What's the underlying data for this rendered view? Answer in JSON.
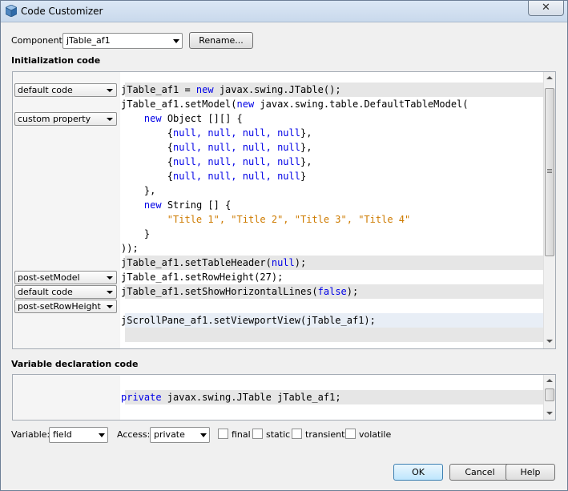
{
  "window": {
    "title": "Code Customizer",
    "close_glyph": "✕"
  },
  "component": {
    "label": "Component:",
    "value": "jTable_af1",
    "rename_label": "Rename..."
  },
  "init": {
    "heading": "Initialization code",
    "combos": [
      "default code",
      "custom property",
      "post-setModel",
      "default code",
      "post-setRowHeight"
    ],
    "lines": [
      [
        "",
        "jTable_af1 = ",
        "new",
        " javax.swing.JTable();"
      ],
      [
        "",
        "jTable_af1.setModel(",
        "new",
        " javax.swing.table.DefaultTableModel("
      ],
      [
        "    ",
        "",
        "new",
        " Object [][] {"
      ],
      [
        "        ",
        "{",
        "null, null, null, null",
        "},"
      ],
      [
        "        ",
        "{",
        "null, null, null, null",
        "},"
      ],
      [
        "        ",
        "{",
        "null, null, null, null",
        "},"
      ],
      [
        "        ",
        "{",
        "null, null, null, null",
        "}"
      ],
      [
        "    ",
        "},",
        "",
        ""
      ],
      [
        "    ",
        "",
        "new",
        " String [] {"
      ],
      [
        "        ",
        "",
        "\"Title 1\", \"Title 2\", \"Title 3\", \"Title 4\"",
        ""
      ],
      [
        "    ",
        "}",
        "",
        ""
      ],
      [
        "",
        "));",
        "",
        ""
      ],
      [
        "",
        "jTable_af1.setTableHeader(",
        "null",
        ");"
      ],
      [
        "",
        "jTable_af1.setRowHeight(27);",
        "",
        ""
      ],
      [
        "",
        "jTable_af1.setShowHorizontalLines(",
        "false",
        ");"
      ],
      [
        "",
        "",
        "",
        ""
      ],
      [
        "",
        "jScrollPane_af1.setViewportView(jTable_af1);",
        "",
        ""
      ]
    ]
  },
  "vardecl": {
    "heading": "Variable declaration code",
    "keyword": "private",
    "rest": " javax.swing.JTable jTable_af1;"
  },
  "bottom": {
    "variable_label": "Variable:",
    "variable_value": "field",
    "access_label": "Access:",
    "access_value": "private",
    "checks": [
      "final",
      "static",
      "transient",
      "volatile"
    ]
  },
  "buttons": {
    "ok": "OK",
    "cancel": "Cancel",
    "help": "Help"
  }
}
